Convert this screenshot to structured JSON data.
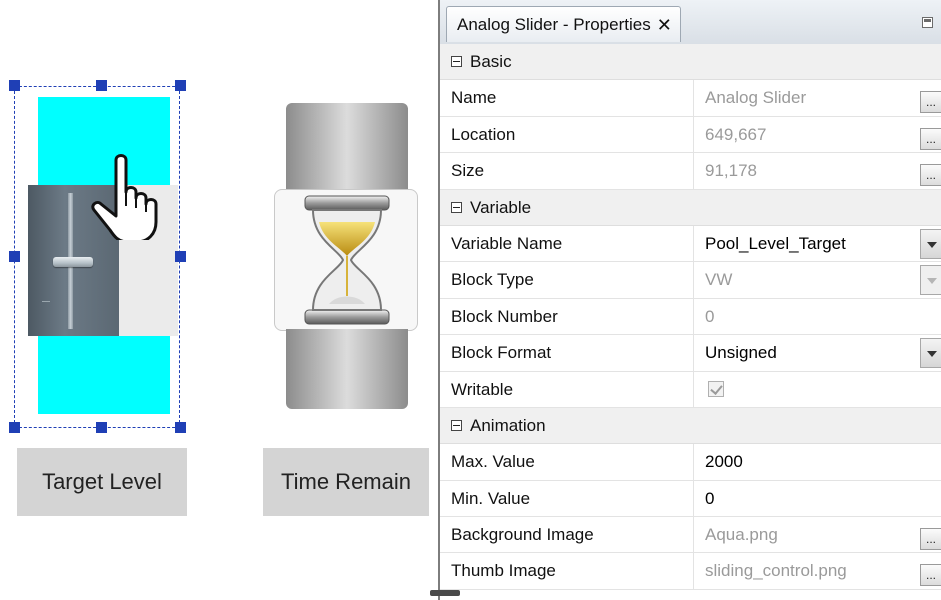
{
  "canvas": {
    "slider_caption": "Target Level",
    "hourglass_caption": "Time Remain"
  },
  "panel": {
    "tab_title": "Analog Slider - Properties",
    "close_glyph": "✕",
    "categories": {
      "basic": "Basic",
      "variable": "Variable",
      "animation": "Animation"
    },
    "properties": {
      "name": {
        "label": "Name",
        "value": "Analog Slider"
      },
      "location": {
        "label": "Location",
        "value": "649,667"
      },
      "size": {
        "label": "Size",
        "value": "91,178"
      },
      "variable_name": {
        "label": "Variable Name",
        "value": "Pool_Level_Target"
      },
      "block_type": {
        "label": "Block Type",
        "value": "VW"
      },
      "block_number": {
        "label": "Block Number",
        "value": "0"
      },
      "block_format": {
        "label": "Block Format",
        "value": "Unsigned"
      },
      "writable": {
        "label": "Writable",
        "checked": true
      },
      "max_value": {
        "label": "Max. Value",
        "value": "2000"
      },
      "min_value": {
        "label": "Min. Value",
        "value": "0"
      },
      "background_image": {
        "label": "Background Image",
        "value": "Aqua.png"
      },
      "thumb_image": {
        "label": "Thumb Image",
        "value": "sliding_control.png"
      }
    },
    "ellipsis_label": "..."
  },
  "colors": {
    "slider_background": "#00ffff",
    "selection": "#1f3fb5"
  },
  "icons": [
    "hand-cursor-icon",
    "hourglass-icon",
    "close-icon",
    "minimize-icon",
    "collapse-icon",
    "dropdown-arrow-icon",
    "ellipsis-icon",
    "checkbox-icon"
  ]
}
